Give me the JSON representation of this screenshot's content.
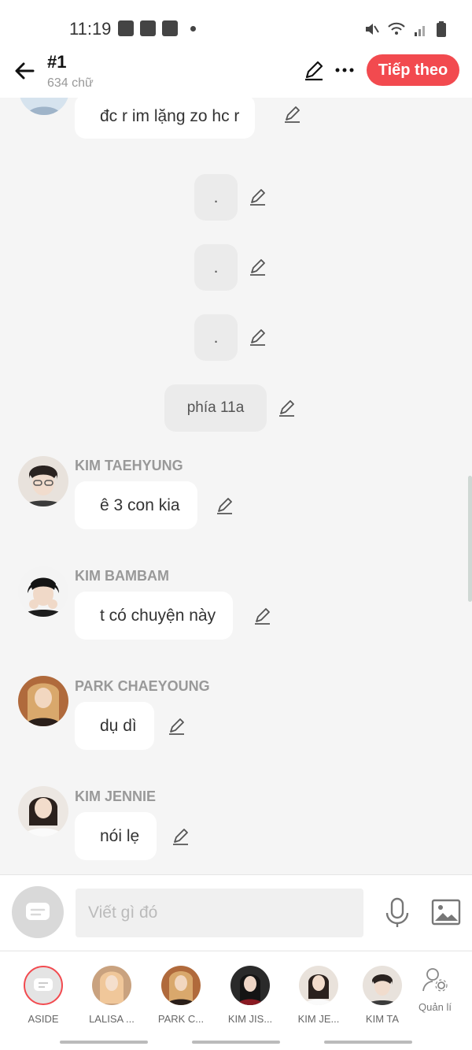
{
  "status": {
    "time": "11:19"
  },
  "header": {
    "title": "#1",
    "subtitle": "634 chữ",
    "next_label": "Tiếp theo"
  },
  "messages": [
    {
      "kind": "message",
      "text": "đc r im lặng zo hc r"
    },
    {
      "kind": "narration",
      "text": "."
    },
    {
      "kind": "narration",
      "text": "."
    },
    {
      "kind": "narration",
      "text": "."
    },
    {
      "kind": "narration",
      "text": "phía 11a"
    },
    {
      "kind": "message",
      "sender": "KIM TAEHYUNG",
      "text": "ê 3 con kia"
    },
    {
      "kind": "message",
      "sender": "KIM BAMBAM",
      "text": "t có chuyện này"
    },
    {
      "kind": "message",
      "sender": "PARK CHAEYOUNG",
      "text": "dụ dì"
    },
    {
      "kind": "message",
      "sender": "KIM JENNIE",
      "text": "nói lẹ"
    }
  ],
  "composer": {
    "placeholder": "Viết gì đó"
  },
  "characters": [
    {
      "name": "ASIDE"
    },
    {
      "name": "LALISA ..."
    },
    {
      "name": "PARK C..."
    },
    {
      "name": "KIM JIS..."
    },
    {
      "name": "KIM JE..."
    },
    {
      "name": "KIM TA"
    }
  ],
  "manage_label": "Quản lí",
  "colors": {
    "accent": "#f24a4f",
    "background": "#f5f5f5"
  }
}
